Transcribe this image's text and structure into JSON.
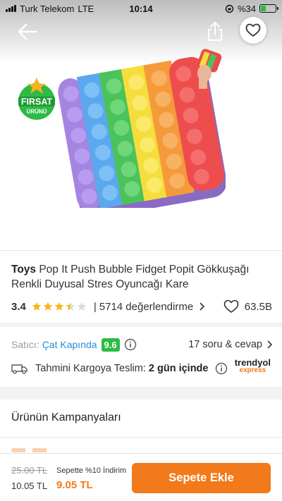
{
  "status_bar": {
    "carrier": "Turk Telekom",
    "network": "LTE",
    "time": "10:14",
    "battery": "%34"
  },
  "header": {
    "back_icon": "arrow-left-icon",
    "share_icon": "share-icon",
    "favorite_icon": "heart-outline-icon"
  },
  "badge": {
    "line1": "FIRSAT",
    "line2": "ÜRÜNÜ"
  },
  "product": {
    "brand": "Toys",
    "name": "Pop It Push Bubble Fidget Popit Gökkuşağı Renkli Duyusal Stres Oyuncağı Kare",
    "rating": "3.4",
    "rating_value": 3.4,
    "rating_max": 5,
    "reviews": "5714 değerlendirme",
    "likes": "63.5B"
  },
  "seller": {
    "label": "Satıcı:",
    "name": "Çat Kapında",
    "score": "9.6",
    "qa": "17 soru & cevap"
  },
  "shipping": {
    "label": "Tahmini Kargoya Teslim:",
    "value": "2 gün içinde",
    "logo_line1": "trendyol",
    "logo_line2": "express"
  },
  "campaigns": {
    "title": "Ürünün Kampanyaları"
  },
  "bottom_bar": {
    "old_price": "25.00 TL",
    "price": "10.05 TL",
    "promo_label": "Sepette %10 İndirim",
    "promo_price": "9.05 TL",
    "add_button": "Sepete Ekle"
  },
  "colors": {
    "accent": "#f27a1a",
    "link": "#2a8ad6",
    "score": "#2dbb45",
    "star": "#f8b31d"
  }
}
